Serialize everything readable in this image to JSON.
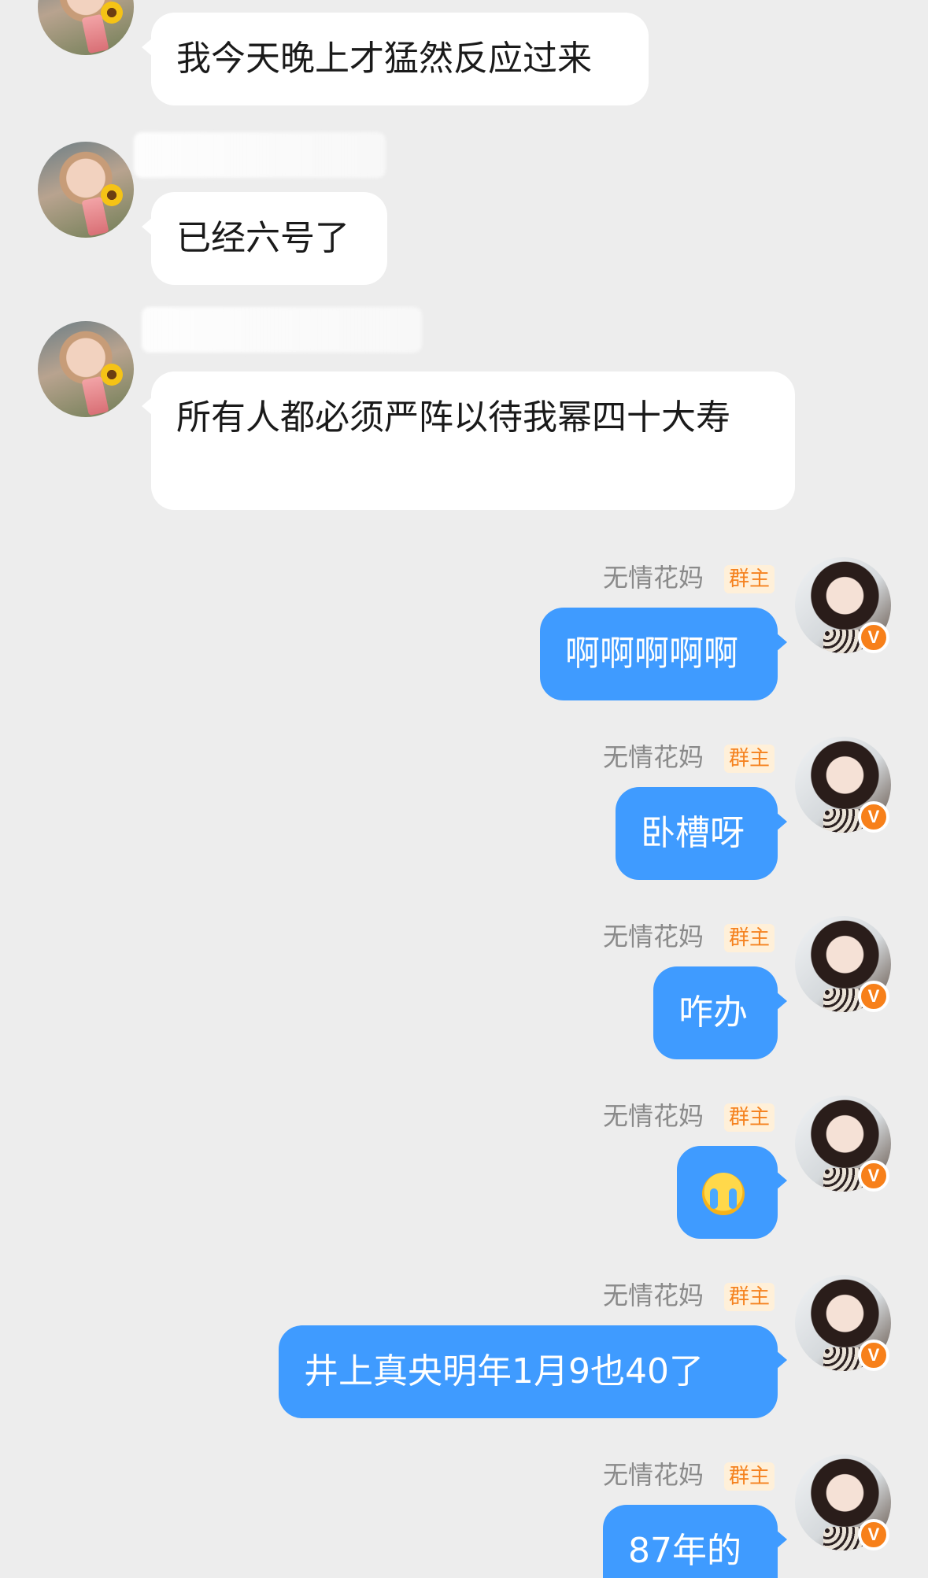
{
  "incoming": [
    {
      "text": "我今天晚上才猛然反应过来"
    },
    {
      "text": "已经六号了"
    },
    {
      "text": "所有人都必须严阵以待我幂四十大寿"
    }
  ],
  "outgoing": [
    {
      "sender": "无情花妈",
      "role": "群主",
      "text": "啊啊啊啊啊"
    },
    {
      "sender": "无情花妈",
      "role": "群主",
      "text": "卧槽呀"
    },
    {
      "sender": "无情花妈",
      "role": "群主",
      "text": "咋办"
    },
    {
      "sender": "无情花妈",
      "role": "群主",
      "emoji": "crying-face-emoji"
    },
    {
      "sender": "无情花妈",
      "role": "群主",
      "text": "井上真央明年1月9也40了"
    },
    {
      "sender": "无情花妈",
      "role": "群主",
      "text": "87年的"
    }
  ],
  "badge": "V",
  "colors": {
    "out_bubble": "#3f9bff",
    "in_bubble": "#ffffff",
    "role_text": "#f5821f",
    "badge": "#f7801a"
  }
}
